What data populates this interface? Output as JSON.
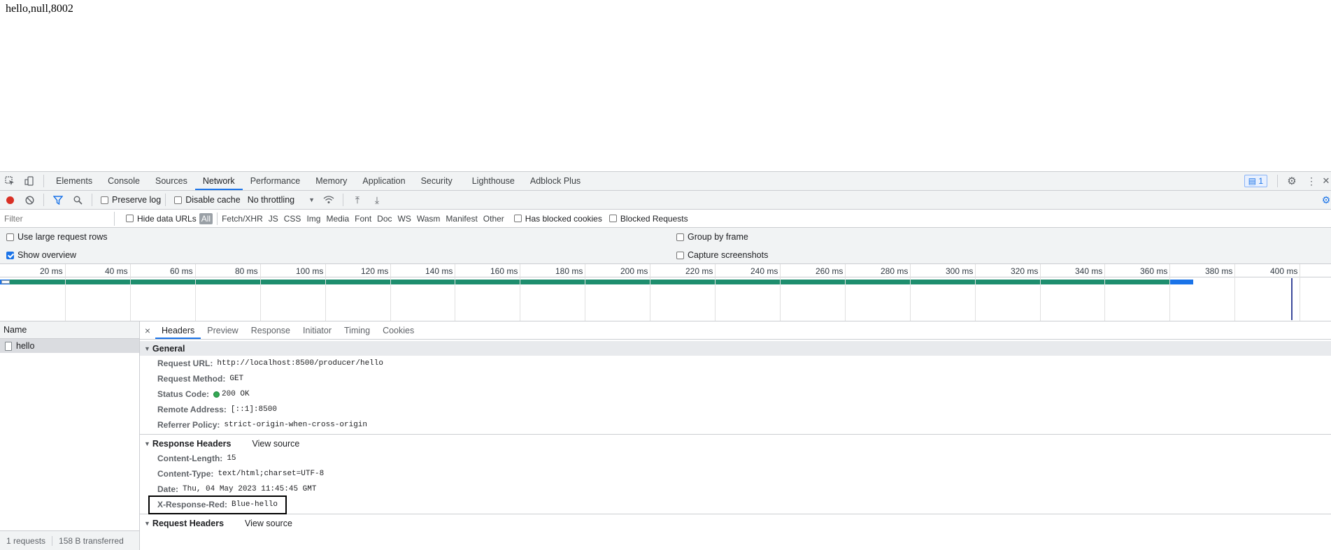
{
  "page": {
    "body_text": "hello,null,8002"
  },
  "devtools": {
    "tabs": [
      "Elements",
      "Console",
      "Sources",
      "Network",
      "Performance",
      "Memory",
      "Application",
      "Security",
      "Lighthouse",
      "Adblock Plus"
    ],
    "active_tab": "Network",
    "issues_count": "1",
    "toolbar": {
      "preserve_log": "Preserve log",
      "disable_cache": "Disable cache",
      "throttling": "No throttling"
    },
    "filter": {
      "placeholder": "Filter",
      "hide_data_urls": "Hide data URLs",
      "types": [
        "All",
        "Fetch/XHR",
        "JS",
        "CSS",
        "Img",
        "Media",
        "Font",
        "Doc",
        "WS",
        "Wasm",
        "Manifest",
        "Other"
      ],
      "has_blocked_cookies": "Has blocked cookies",
      "blocked_requests": "Blocked Requests"
    },
    "settings": {
      "large_rows": "Use large request rows",
      "show_overview": "Show overview",
      "group_by_frame": "Group by frame",
      "capture_screenshots": "Capture screenshots"
    },
    "overview_ticks": [
      "20 ms",
      "40 ms",
      "60 ms",
      "80 ms",
      "100 ms",
      "120 ms",
      "140 ms",
      "160 ms",
      "180 ms",
      "200 ms",
      "220 ms",
      "240 ms",
      "260 ms",
      "280 ms",
      "300 ms",
      "320 ms",
      "340 ms",
      "360 ms",
      "380 ms",
      "400 ms"
    ],
    "requests": {
      "name_header": "Name",
      "rows": [
        {
          "name": "hello"
        }
      ],
      "summary_requests": "1 requests",
      "summary_transferred": "158 B transferred"
    },
    "details": {
      "tabs": [
        "Headers",
        "Preview",
        "Response",
        "Initiator",
        "Timing",
        "Cookies"
      ],
      "active_tab": "Headers",
      "general": {
        "title": "General",
        "rows": [
          {
            "key": "Request URL:",
            "value": "http://localhost:8500/producer/hello"
          },
          {
            "key": "Request Method:",
            "value": "GET"
          },
          {
            "key": "Status Code:",
            "value": "200 OK"
          },
          {
            "key": "Remote Address:",
            "value": "[::1]:8500"
          },
          {
            "key": "Referrer Policy:",
            "value": "strict-origin-when-cross-origin"
          }
        ]
      },
      "response_headers": {
        "title": "Response Headers",
        "view_source": "View source",
        "rows": [
          {
            "key": "Content-Length:",
            "value": "15"
          },
          {
            "key": "Content-Type:",
            "value": "text/html;charset=UTF-8"
          },
          {
            "key": "Date:",
            "value": "Thu, 04 May 2023 11:45:45 GMT"
          },
          {
            "key": "X-Response-Red:",
            "value": "Blue-hello"
          }
        ]
      },
      "request_headers": {
        "title": "Request Headers",
        "view_source": "View source"
      }
    },
    "colors": {
      "accent": "#1a73e8",
      "status_ok": "#34a853",
      "timing_bar": "#1a73e8",
      "timing_bar_green": "#1e8e6e"
    }
  }
}
